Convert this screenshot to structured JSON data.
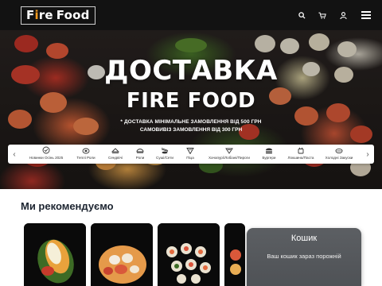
{
  "header": {
    "logo_prefix": "Fire",
    "logo_suffix": "Food",
    "icons": [
      "search-icon",
      "cart-icon",
      "user-icon",
      "menu-icon"
    ]
  },
  "hero": {
    "title": "ДОСТАВКА",
    "brand": "FIRE FOOD",
    "note_min_order": "* ДОСТАВКА МІНІМАЛЬНЕ ЗАМОВЛЕННЯ ВІД 500 ГРН",
    "note_pickup": "САМОВИВІЗ ЗАМОВЛЕННЯ ВІД 300 ГРН"
  },
  "categories": [
    {
      "label": "Новинки Осінь 2025",
      "icon": "new-badge-icon"
    },
    {
      "label": "Теплі Роли",
      "icon": "warm-roll-icon"
    },
    {
      "label": "Сендвічі",
      "icon": "sandwich-icon"
    },
    {
      "label": "Роли",
      "icon": "roll-icon"
    },
    {
      "label": "Суші/Сети",
      "icon": "sushi-set-icon"
    },
    {
      "label": "Піца",
      "icon": "pizza-icon"
    },
    {
      "label": "Хачапурі/Лобіані/Пироги",
      "icon": "khachapuri-icon"
    },
    {
      "label": "Бургери",
      "icon": "burger-icon"
    },
    {
      "label": "Локшина/Паста",
      "icon": "noodles-icon"
    },
    {
      "label": "Холодні Закуски",
      "icon": "cold-snack-icon"
    }
  ],
  "recommend": {
    "title": "Ми рекомендуємо"
  },
  "cart": {
    "title": "Кошик",
    "empty_text": "Ваш кошик зараз порожній"
  },
  "colors": {
    "header_bg": "#121212",
    "accent_flame": "#f29a1e",
    "cart_bg": "#5c5f63"
  }
}
